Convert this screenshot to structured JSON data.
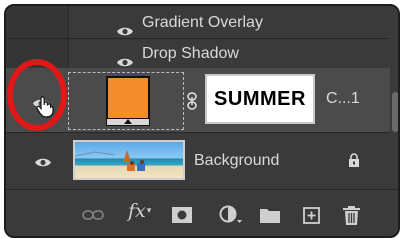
{
  "effects": [
    {
      "label": "Gradient Overlay",
      "icon": "eye-icon"
    },
    {
      "label": "Drop Shadow",
      "icon": "eye-icon"
    }
  ],
  "layers": [
    {
      "name": "C...1",
      "type": "color-fill",
      "fill_color": "#f28c2c",
      "mask_text": "SUMMER",
      "selected": true,
      "visible": true
    },
    {
      "name": "Background",
      "type": "image",
      "locked": true,
      "visible": true
    }
  ],
  "toolbar": {
    "buttons": [
      {
        "name": "link-layers-button",
        "icon": "link-icon",
        "enabled": false
      },
      {
        "name": "add-layer-style-button",
        "icon": "fx-icon",
        "text": "fx"
      },
      {
        "name": "add-mask-button",
        "icon": "mask-icon"
      },
      {
        "name": "new-adjustment-layer-button",
        "icon": "half-circle-icon"
      },
      {
        "name": "new-group-button",
        "icon": "folder-icon"
      },
      {
        "name": "new-layer-button",
        "icon": "new-layer-icon"
      },
      {
        "name": "delete-layer-button",
        "icon": "trash-icon"
      }
    ]
  },
  "annotation": {
    "ring_color": "#e01818",
    "highlights": "visibility-toggle"
  },
  "colors": {
    "panel_bg": "#3a3a3a",
    "selected_row": "#4b4b4b",
    "text": "#d9d9d9"
  }
}
